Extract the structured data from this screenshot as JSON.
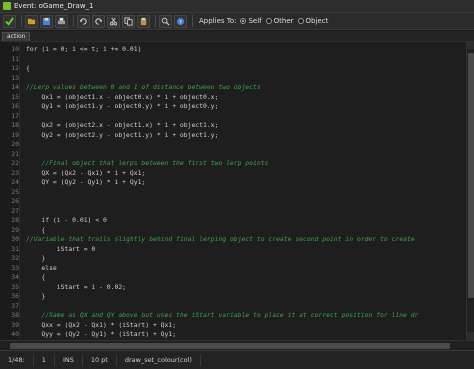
{
  "window": {
    "title": "Event: oGame_Draw_1"
  },
  "toolbar": {
    "applies_label": "Applies To:",
    "radio_self": "Self",
    "radio_other": "Other",
    "radio_object": "Object"
  },
  "tab": {
    "label": "action"
  },
  "code": {
    "lines": [
      {
        "n": "10",
        "t": "for (i = 0; i <= t; i += 0.01)"
      },
      {
        "n": "11",
        "t": ""
      },
      {
        "n": "12",
        "t": "{"
      },
      {
        "n": "13",
        "t": ""
      },
      {
        "n": "14",
        "t": "//Lerp values between 0 and 1 of distance between two objects"
      },
      {
        "n": "15",
        "t": "    Qx1 = (object1.x - object0.x) * i + object0.x;"
      },
      {
        "n": "16",
        "t": "    Qy1 = (object1.y - object0.y) * i + object0.y;"
      },
      {
        "n": "17",
        "t": ""
      },
      {
        "n": "18",
        "t": "    Qx2 = (object2.x - object1.x) * i + object1.x;"
      },
      {
        "n": "19",
        "t": "    Qy2 = (object2.y - object1.y) * i + object1.y;"
      },
      {
        "n": "20",
        "t": ""
      },
      {
        "n": "21",
        "t": ""
      },
      {
        "n": "22",
        "t": "    //Final object that lerps between the first two lerp points"
      },
      {
        "n": "23",
        "t": "    QX = (Qx2 - Qx1) * i + Qx1;"
      },
      {
        "n": "24",
        "t": "    QY = (Qy2 - Qy1) * i + Qy1;"
      },
      {
        "n": "25",
        "t": ""
      },
      {
        "n": "26",
        "t": ""
      },
      {
        "n": "27",
        "t": ""
      },
      {
        "n": "28",
        "t": "    if (i - 0.01) < 0"
      },
      {
        "n": "29",
        "t": "    {"
      },
      {
        "n": "30",
        "t": "//Variable that trails slightly behind final lerping object to create second point in order to create"
      },
      {
        "n": "31",
        "t": "        iStart = 0"
      },
      {
        "n": "32",
        "t": "    }"
      },
      {
        "n": "33",
        "t": "    else"
      },
      {
        "n": "34",
        "t": "    {"
      },
      {
        "n": "35",
        "t": "        iStart = i - 0.02;"
      },
      {
        "n": "36",
        "t": "    }"
      },
      {
        "n": "37",
        "t": ""
      },
      {
        "n": "38",
        "t": "    //Same as QX and QY above but uses the iStart variable to place it at correct position for line dr"
      },
      {
        "n": "39",
        "t": "    Qxx = (Qx2 - Qx1) * (iStart) + Qx1;"
      },
      {
        "n": "40",
        "t": "    Qyy = (Qy2 - Qy1) * (iStart) + Qy1;"
      }
    ]
  },
  "status": {
    "position": "1/48:",
    "col": "1",
    "mode": "INS",
    "font_size": "10 pt",
    "hint": "draw_set_colour(col)"
  }
}
